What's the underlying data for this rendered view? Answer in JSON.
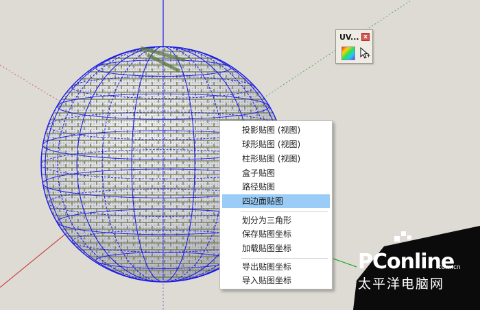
{
  "uv_toolbar": {
    "title": "UV...",
    "close_glyph": "x",
    "buttons": [
      {
        "icon": "rainbow-texture-icon"
      },
      {
        "icon": "pointer-cursor-icon"
      }
    ]
  },
  "context_menu": {
    "items": [
      {
        "label": "投影贴图 (视图)"
      },
      {
        "label": "球形贴图 (视图)"
      },
      {
        "label": "柱形贴图 (视图)"
      },
      {
        "label": "盒子贴图"
      },
      {
        "label": "路径贴图"
      },
      {
        "label": "四边面贴图",
        "highlighted": true
      },
      {
        "label": "划分为三角形"
      },
      {
        "label": "保存贴图坐标"
      },
      {
        "label": "加载贴图坐标"
      },
      {
        "label": "导出贴图坐标"
      },
      {
        "label": "导入贴图坐标"
      }
    ]
  },
  "watermark": {
    "brand": "PConline",
    "domain": ".com.cn",
    "slogan": "太平洋电脑网"
  },
  "colors": {
    "background": "#dedbd4",
    "wireframe": "#1a1aee",
    "menu_highlight": "#99ccf7",
    "axis_red": "#c44",
    "axis_green": "#2a2",
    "axis_blue": "#22c"
  }
}
